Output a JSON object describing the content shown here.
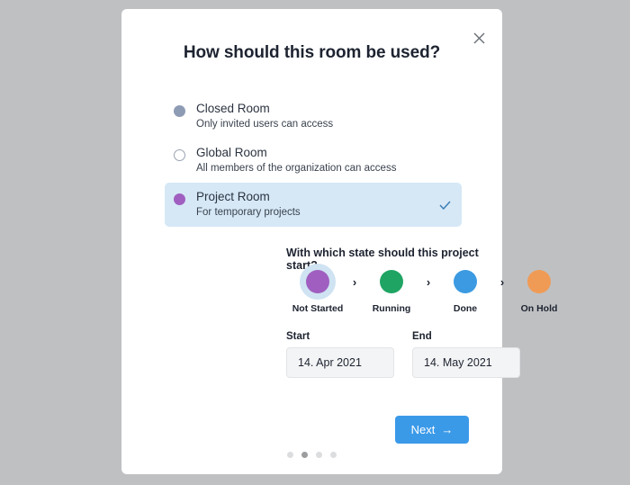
{
  "dialog": {
    "title": "How should this room be used?",
    "close_icon": "close-icon"
  },
  "options": [
    {
      "label": "Closed Room",
      "description": "Only invited users can access",
      "radio": "filled-gray",
      "selected": false
    },
    {
      "label": "Global Room",
      "description": "All members of the organization can access",
      "radio": "empty",
      "selected": false
    },
    {
      "label": "Project Room",
      "description": "For temporary projects",
      "radio": "filled-purple",
      "selected": true
    }
  ],
  "state_section": {
    "label": "With which state should this project start?",
    "separator": "›",
    "states": [
      {
        "name": "Not Started",
        "color": "#a05fc0",
        "active": true
      },
      {
        "name": "Running",
        "color": "#1fa463",
        "active": false
      },
      {
        "name": "Done",
        "color": "#3b9ae1",
        "active": false
      },
      {
        "name": "On Hold",
        "color": "#ef9b55",
        "active": false
      }
    ]
  },
  "dates": {
    "start_label": "Start",
    "start_value": "14. Apr 2021",
    "end_label": "End",
    "end_value": "14. May 2021"
  },
  "footer": {
    "next_label": "Next",
    "next_arrow": "→",
    "pager": {
      "count": 4,
      "active_index": 1
    }
  },
  "colors": {
    "accent_blue": "#3b9ae8",
    "selected_row_bg": "#d6e8f6",
    "page_background": "#bfc0c2",
    "card_background": "#ffffff",
    "title_text": "#1d2330"
  }
}
